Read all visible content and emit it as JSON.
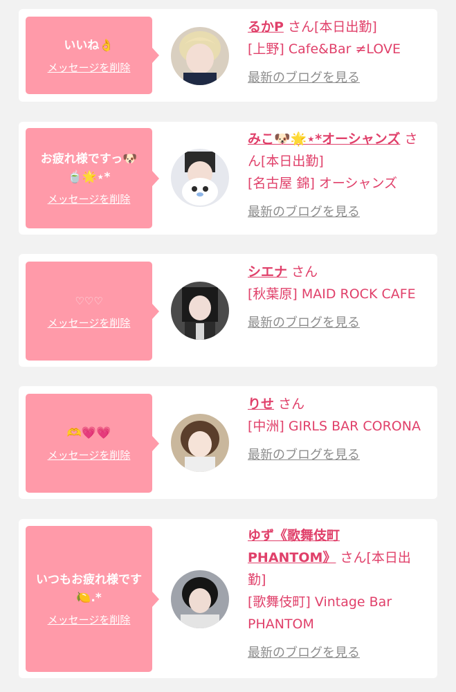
{
  "items": [
    {
      "message": "いいね👌",
      "delete_label": "メッセージを削除",
      "name": "るかP",
      "san": "さん",
      "status": "[本日出勤]",
      "shop": "[上野] Cafe&Bar ≠LOVE",
      "blog_label": "最新のブログを見る"
    },
    {
      "message": "お疲れ様ですっ🐶\n🍵🌟⋆*",
      "delete_label": "メッセージを削除",
      "name": "みこ🐶🌟⋆*オーシャンズ",
      "san": "さん",
      "status": "[本日出勤]",
      "shop": "[名古屋 錦] オーシャンズ",
      "blog_label": "最新のブログを見る"
    },
    {
      "message": "♡♡♡",
      "delete_label": "メッセージを削除",
      "name": "シエナ",
      "san": "さん",
      "status": "",
      "shop": "[秋葉原] MAID ROCK CAFE",
      "blog_label": "最新のブログを見る"
    },
    {
      "message": "🫶💗💗",
      "delete_label": "メッセージを削除",
      "name": "りせ",
      "san": "さん",
      "status": "",
      "shop": "[中洲] GIRLS BAR CORONA",
      "blog_label": "最新のブログを見る"
    },
    {
      "message": "いつもお疲れ様です🍋.*",
      "delete_label": "メッセージを削除",
      "name": "ゆず《歌舞伎町 PHANTOM》",
      "san": "さん",
      "status": "[本日出勤]",
      "shop": "[歌舞伎町] Vintage Bar PHANTOM",
      "blog_label": "最新のブログを見る"
    }
  ],
  "colors": {
    "background": "#f2f2f2",
    "card": "#ffffff",
    "bubble": "#ff9aa9",
    "accent": "#e0406a",
    "muted_link": "#8c8c8c"
  }
}
